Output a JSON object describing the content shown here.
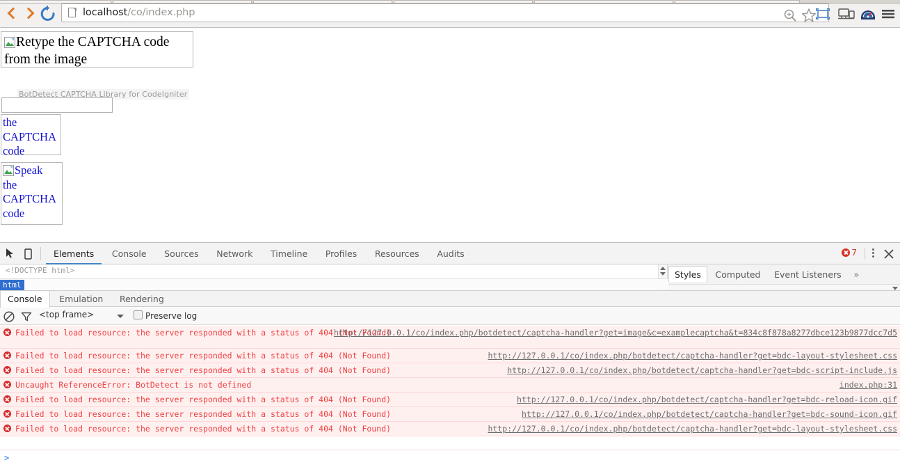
{
  "browser": {
    "back_label": "Back",
    "forward_label": "Forward",
    "reload_label": "Reload",
    "url_host": "localhost",
    "url_path": "/co/index.php",
    "url_full": "localhost/co/index.php",
    "icons": {
      "page": "page-icon",
      "zoom": "zoom-icon",
      "star": "bookmark-star-icon",
      "screenshot": "screenshot-icon",
      "devices": "responsive-devices-icon",
      "dial": "speedometer-icon",
      "menu": "hamburger-menu-icon"
    }
  },
  "page": {
    "captcha_image_alt": "Retype the CAPTCHA code from the image",
    "credits": "BotDetect CAPTCHA Library for CodeIgniter",
    "input_value": "",
    "input_placeholder": "",
    "reload_link_lines": [
      "the",
      "CAPTCHA",
      "code"
    ],
    "sound_link_lines": [
      "Speak",
      "the",
      "CAPTCHA",
      "code"
    ]
  },
  "devtools": {
    "tabs": [
      {
        "label": "Elements",
        "active": true
      },
      {
        "label": "Console",
        "active": false
      },
      {
        "label": "Sources",
        "active": false
      },
      {
        "label": "Network",
        "active": false
      },
      {
        "label": "Timeline",
        "active": false
      },
      {
        "label": "Profiles",
        "active": false
      },
      {
        "label": "Resources",
        "active": false
      },
      {
        "label": "Audits",
        "active": false
      }
    ],
    "error_count": "7",
    "elements": {
      "doctype": "<!DOCTYPE html>",
      "breadcrumb": "html"
    },
    "styles_tabs": [
      {
        "label": "Styles",
        "active": true
      },
      {
        "label": "Computed",
        "active": false
      },
      {
        "label": "Event Listeners",
        "active": false
      }
    ],
    "styles_more": "»",
    "drawer_tabs": [
      {
        "label": "Console",
        "active": true
      },
      {
        "label": "Emulation",
        "active": false
      },
      {
        "label": "Rendering",
        "active": false
      }
    ],
    "console_toolbar": {
      "clear_label": "Clear console",
      "filter_label": "Filter",
      "frame": "<top frame>",
      "preserve_log": "Preserve log",
      "preserve_log_checked": false
    },
    "console_messages": [
      {
        "text": "Failed to load resource: the server responded with a status of 404 (Not Found)",
        "source": "http://127.0.0.1/co/index.php/botdetect/captcha-handler?get=image&c=examplecaptcha&t=834c8f878a8277dbce123b9877dcc7d5",
        "wrapped": true
      },
      {
        "text": "Failed to load resource: the server responded with a status of 404 (Not Found)",
        "source": "http://127.0.0.1/co/index.php/botdetect/captcha-handler?get=bdc-layout-stylesheet.css",
        "wrapped": false
      },
      {
        "text": "Failed to load resource: the server responded with a status of 404 (Not Found)",
        "source": "http://127.0.0.1/co/index.php/botdetect/captcha-handler?get=bdc-script-include.js",
        "wrapped": false
      },
      {
        "text": "Uncaught ReferenceError: BotDetect is not defined",
        "source": "index.php:31",
        "wrapped": false
      },
      {
        "text": "Failed to load resource: the server responded with a status of 404 (Not Found)",
        "source": "http://127.0.0.1/co/index.php/botdetect/captcha-handler?get=bdc-reload-icon.gif",
        "wrapped": false
      },
      {
        "text": "Failed to load resource: the server responded with a status of 404 (Not Found)",
        "source": "http://127.0.0.1/co/index.php/botdetect/captcha-handler?get=bdc-sound-icon.gif",
        "wrapped": false
      },
      {
        "text": "Failed to load resource: the server responded with a status of 404 (Not Found)",
        "source": "http://127.0.0.1/co/index.php/botdetect/captcha-handler?get=bdc-layout-stylesheet.css",
        "wrapped": false
      }
    ],
    "console_prompt": ">"
  },
  "colors": {
    "error_red": "#f04142",
    "error_bg": "#fff0f0",
    "link_blue": "#1414d6",
    "accent_blue": "#4285c8",
    "orange": "#e07b2a"
  }
}
